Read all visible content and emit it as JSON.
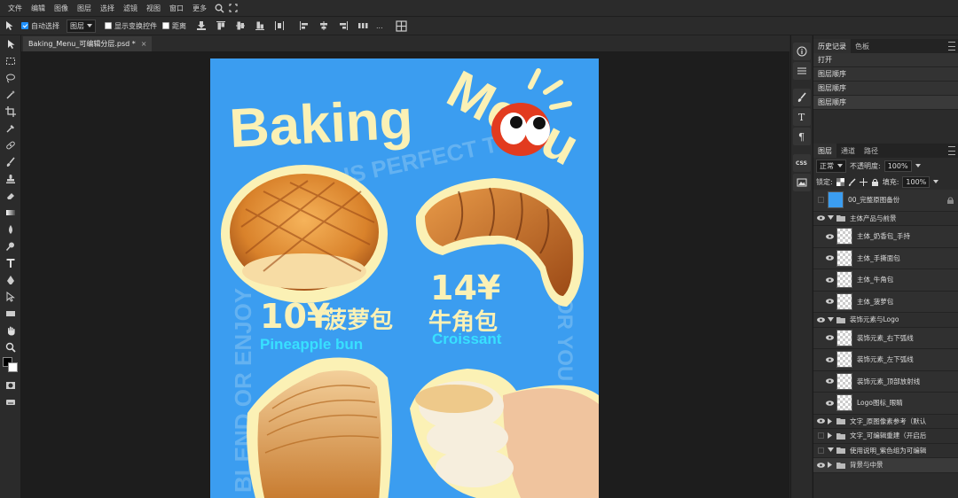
{
  "menu": [
    "文件",
    "编辑",
    "图像",
    "图层",
    "选择",
    "滤镜",
    "视图",
    "窗口",
    "更多"
  ],
  "options": {
    "auto_select_label": "自动选择",
    "target_value": "图层",
    "show_transform_label": "显示变换控件",
    "distance_label": "距离",
    "ellipsis": "..."
  },
  "document": {
    "tab_title": "Baking_Menu_可编辑分层.psd *",
    "close_glyph": "×"
  },
  "history": {
    "tabs": [
      "历史记录",
      "色板"
    ],
    "items": [
      "打开",
      "图层顺序",
      "图层顺序",
      "图层顺序"
    ]
  },
  "layers": {
    "tabs": [
      "图层",
      "通道",
      "路径"
    ],
    "blend_mode": "正常",
    "opacity_label": "不透明度:",
    "opacity_value": "100%",
    "lock_label": "锁定:",
    "fill_label": "填充:",
    "fill_value": "100%",
    "items": [
      {
        "name": "00_完整原图备份",
        "kind": "photo"
      },
      {
        "name": "主体产品与前景",
        "kind": "group"
      },
      {
        "name": "主体_奶香包_手持",
        "kind": "layer"
      },
      {
        "name": "主体_手撕面包",
        "kind": "layer"
      },
      {
        "name": "主体_牛角包",
        "kind": "layer"
      },
      {
        "name": "主体_菠萝包",
        "kind": "layer"
      },
      {
        "name": "装饰元素与Logo",
        "kind": "group"
      },
      {
        "name": "装饰元素_右下弧线",
        "kind": "layer"
      },
      {
        "name": "装饰元素_左下弧线",
        "kind": "layer"
      },
      {
        "name": "装饰元素_顶部放射线",
        "kind": "layer"
      },
      {
        "name": "Logo图标_眼睛",
        "kind": "layer"
      },
      {
        "name": "文字_原图像素参考（默认",
        "kind": "group"
      },
      {
        "name": "文字_可编辑重建（开启后",
        "kind": "group"
      },
      {
        "name": "使用说明_紫色组为可编辑",
        "kind": "group"
      },
      {
        "name": "背景与中景",
        "kind": "group"
      }
    ]
  },
  "poster": {
    "title_baking": "Baking",
    "title_menu": "Menu",
    "arc_text_top": "IS PERFECT TO",
    "side_text_left": "BLEND OR ENJOY",
    "side_text_right": "OR YOU",
    "item1_price": "10¥",
    "item1_name_cn": "菠萝包",
    "item1_name_en": "Pineapple bun",
    "item2_price": "14¥",
    "item2_name_cn": "牛角包",
    "item2_name_en": "Croissant"
  },
  "colors": {
    "poster_bg": "#3b9df0",
    "title_cream": "#fbf1b5",
    "en_label_cyan": "#38e0ff",
    "eye_red": "#e23b1f"
  }
}
